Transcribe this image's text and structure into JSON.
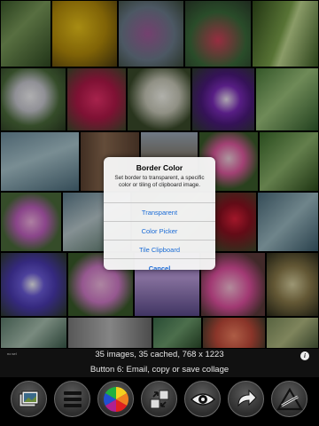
{
  "dialog": {
    "title": "Border Color",
    "message": "Set border to transparent, a specific color or tiling of clipboard image.",
    "options": [
      "Transparent",
      "Color Picker",
      "Tile Clipboard",
      "Cancel"
    ]
  },
  "status": {
    "small_label": "no sel",
    "count_line": "35 images, 35 cached, 768 x 1223",
    "hint_line": "Button 6: Email, copy or save collage",
    "info_glyph": "i"
  },
  "toolbar": {
    "buttons": [
      {
        "name": "photos-icon"
      },
      {
        "name": "list-icon"
      },
      {
        "name": "color-wheel-icon"
      },
      {
        "name": "shuffle-icon"
      },
      {
        "name": "eye-icon"
      },
      {
        "name": "redo-icon"
      },
      {
        "name": "tools-icon"
      }
    ]
  }
}
